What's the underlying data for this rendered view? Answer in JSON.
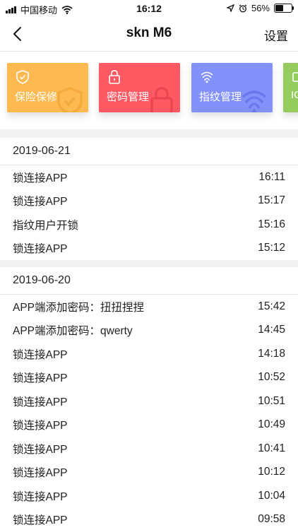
{
  "status_bar": {
    "carrier": "中国移动",
    "time": "16:12",
    "battery": "56%",
    "battery_level": 0.56
  },
  "nav": {
    "title": "skn M6",
    "settings_label": "设置"
  },
  "cards": [
    {
      "label": "保险保修",
      "color": "#ffb951",
      "icon": "shield-check-icon"
    },
    {
      "label": "密码管理",
      "color": "#ff5a64",
      "icon": "lock-icon"
    },
    {
      "label": "指纹管理",
      "color": "#8391fb",
      "icon": "fingerprint-icon"
    },
    {
      "label": "IC",
      "color": "#94cc5f",
      "icon": "card-icon"
    }
  ],
  "logs": [
    {
      "date": "2019-06-21",
      "entries": [
        {
          "event": "锁连接APP",
          "time": "16:11"
        },
        {
          "event": "锁连接APP",
          "time": "15:17"
        },
        {
          "event": "指纹用户开锁",
          "time": "15:16"
        },
        {
          "event": "锁连接APP",
          "time": "15:12"
        }
      ]
    },
    {
      "date": "2019-06-20",
      "entries": [
        {
          "event": "APP端添加密码：扭扭捏捏",
          "time": "15:42"
        },
        {
          "event": "APP端添加密码：qwerty",
          "time": "14:45"
        },
        {
          "event": "锁连接APP",
          "time": "14:18"
        },
        {
          "event": "锁连接APP",
          "time": "10:52"
        },
        {
          "event": "锁连接APP",
          "time": "10:51"
        },
        {
          "event": "锁连接APP",
          "time": "10:49"
        },
        {
          "event": "锁连接APP",
          "time": "10:41"
        },
        {
          "event": "锁连接APP",
          "time": "10:12"
        },
        {
          "event": "锁连接APP",
          "time": "10:04"
        },
        {
          "event": "锁连接APP",
          "time": "09:58"
        }
      ]
    }
  ]
}
